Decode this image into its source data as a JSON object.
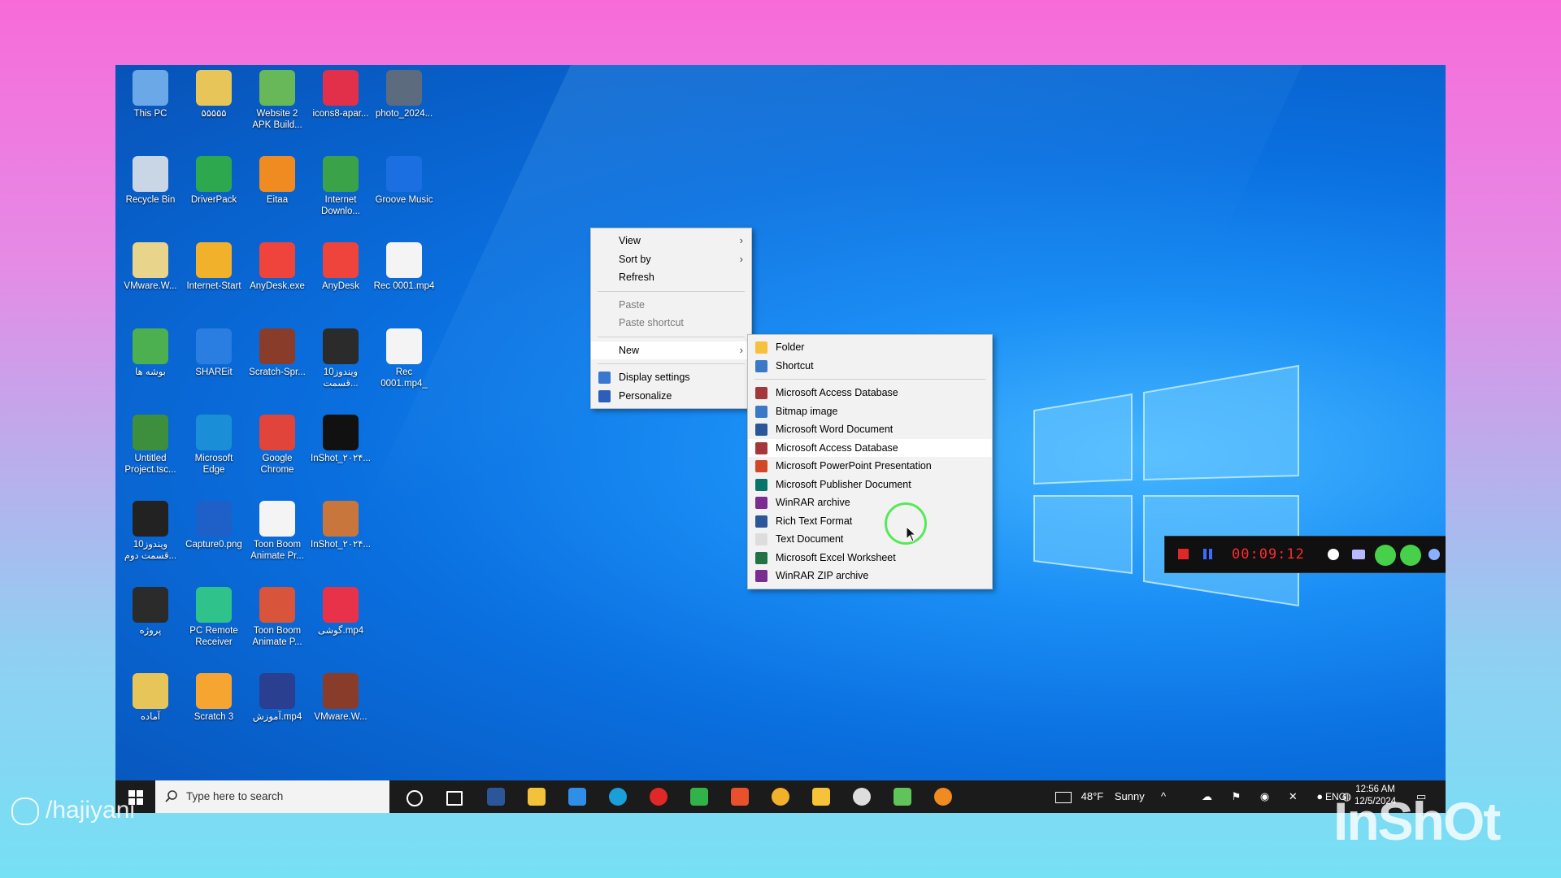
{
  "desktop_icons": [
    {
      "label": "This PC",
      "color": "#6aa8e8"
    },
    {
      "label": "۵۵۵۵۵",
      "color": "#e8c558"
    },
    {
      "label": "Website 2 APK Build...",
      "color": "#68b85a"
    },
    {
      "label": "icons8-apar...",
      "color": "#e2304a"
    },
    {
      "label": "photo_2024...",
      "color": "#5c6b7e"
    },
    {
      "label": "Recycle Bin",
      "color": "#c8d6e6"
    },
    {
      "label": "DriverPack",
      "color": "#2ea84f"
    },
    {
      "label": "Eitaa",
      "color": "#f08b22"
    },
    {
      "label": "Internet Downlo...",
      "color": "#3aa34a"
    },
    {
      "label": "Groove Music",
      "color": "#1c6fe0"
    },
    {
      "label": "VMware.W...",
      "color": "#e8d48a"
    },
    {
      "label": "Internet-Start",
      "color": "#f2b12b"
    },
    {
      "label": "AnyDesk.exe",
      "color": "#ef443b"
    },
    {
      "label": "AnyDesk",
      "color": "#ef443b"
    },
    {
      "label": "Rec 0001.mp4",
      "color": "#f4f4f4"
    },
    {
      "label": "بوشه ها",
      "color": "#4caf50"
    },
    {
      "label": "SHAREit",
      "color": "#2a7de1"
    },
    {
      "label": "Scratch-Spr...",
      "color": "#8a3c2b"
    },
    {
      "label": "ویندوز10 قسمت...",
      "color": "#2b2b2b"
    },
    {
      "label": "Rec 0001.mp4_",
      "color": "#f4f4f4"
    },
    {
      "label": "Untitled Project.tsc...",
      "color": "#3d8f3d"
    },
    {
      "label": "Microsoft Edge",
      "color": "#1a8fd8"
    },
    {
      "label": "Google Chrome",
      "color": "#e0443a"
    },
    {
      "label": "InShot_۲۰۲۴...",
      "color": "#111111"
    },
    {
      "label": "ویندوز10 قسمت دوم...",
      "color": "#222222"
    },
    {
      "label": "Capture0.png",
      "color": "#1f5fc8"
    },
    {
      "label": "Toon Boom Animate Pr...",
      "color": "#f4f4f4"
    },
    {
      "label": "InShot_۲۰۲۴...",
      "color": "#c9763c"
    },
    {
      "label": "پروژه",
      "color": "#2b2b2b"
    },
    {
      "label": "PC Remote Receiver",
      "color": "#2fc28a"
    },
    {
      "label": "Toon Boom Animate P...",
      "color": "#d8543a"
    },
    {
      "label": "گوشی.mp4",
      "color": "#e8324a"
    },
    {
      "label": "آماده",
      "color": "#e8c558"
    },
    {
      "label": "Scratch 3",
      "color": "#f7a531"
    },
    {
      "label": "آموزش.mp4",
      "color": "#2a3f8f"
    },
    {
      "label": "VMware.W...",
      "color": "#8a3c2b"
    }
  ],
  "context_menu": {
    "items": [
      {
        "label": "View",
        "submenu": true
      },
      {
        "label": "Sort by",
        "submenu": true
      },
      {
        "label": "Refresh"
      },
      {
        "label": "Paste",
        "disabled": true
      },
      {
        "label": "Paste shortcut",
        "disabled": true
      },
      {
        "label": "New",
        "submenu": true
      },
      {
        "label": "Display settings",
        "icon": "display-icon"
      },
      {
        "label": "Personalize",
        "icon": "personalize-icon"
      }
    ]
  },
  "new_submenu": {
    "items": [
      {
        "label": "Folder",
        "icon": "folder-icon",
        "color": "#f6c23e"
      },
      {
        "label": "Shortcut",
        "icon": "shortcut-icon",
        "color": "#3c78c8"
      },
      {
        "label": "Microsoft Access Database",
        "icon": "access-icon",
        "color": "#a4373a"
      },
      {
        "label": "Bitmap image",
        "icon": "bitmap-icon",
        "color": "#3c78c8"
      },
      {
        "label": "Microsoft Word Document",
        "icon": "word-icon",
        "color": "#2b579a"
      },
      {
        "label": "Microsoft Access Database",
        "icon": "access-icon",
        "color": "#a4373a"
      },
      {
        "label": "Microsoft PowerPoint Presentation",
        "icon": "powerpoint-icon",
        "color": "#d24726"
      },
      {
        "label": "Microsoft Publisher Document",
        "icon": "publisher-icon",
        "color": "#077568"
      },
      {
        "label": "WinRAR archive",
        "icon": "winrar-icon",
        "color": "#7b2c8f"
      },
      {
        "label": "Rich Text Format",
        "icon": "rtf-icon",
        "color": "#2b579a"
      },
      {
        "label": "Text Document",
        "icon": "text-document-icon",
        "color": "#dddddd"
      },
      {
        "label": "Microsoft Excel Worksheet",
        "icon": "excel-icon",
        "color": "#217346"
      },
      {
        "label": "WinRAR ZIP archive",
        "icon": "winrar-zip-icon",
        "color": "#7b2c8f"
      }
    ],
    "highlighted_index": 5
  },
  "recorder": {
    "timer": "00:09:12"
  },
  "taskbar": {
    "search_placeholder": "Type here to search",
    "weather_temp": "48°F",
    "weather_text": "Sunny",
    "language": "ENG",
    "time": "12:56 AM",
    "date": "12/5/2024"
  },
  "watermarks": {
    "user": "/hajiyani",
    "brand": "InShOt"
  }
}
